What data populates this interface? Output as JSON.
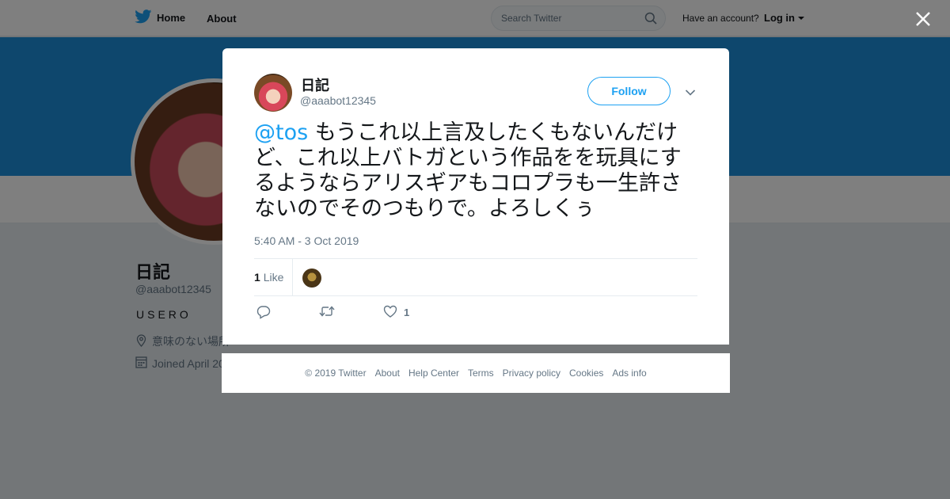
{
  "topbar": {
    "home_label": "Home",
    "about_label": "About",
    "search_placeholder": "Search Twitter",
    "account_prompt": "Have an account?",
    "login_label": "Log in"
  },
  "profile": {
    "name": "日記",
    "handle": "@aaabot12345",
    "bio": "USERO",
    "location": "意味のない場所",
    "joined": "Joined April 20"
  },
  "tweet": {
    "author_name": "日記",
    "author_handle": "@aaabot12345",
    "follow_label": "Follow",
    "mention": "@tos",
    "text": " もうこれ以上言及したくもないんだけど、これ以上バトガという作品をを玩具にするようならアリスギアもコロプラも一生許さないのでそのつもりで。よろしくぅ",
    "timestamp": "5:40 AM - 3 Oct 2019",
    "likes_count": "1",
    "likes_label": "Like",
    "action_like_count": "1"
  },
  "footer": {
    "links": [
      "© 2019 Twitter",
      "About",
      "Help Center",
      "Terms",
      "Privacy policy",
      "Cookies",
      "Ads info"
    ]
  },
  "colors": {
    "accent": "#1da1f2",
    "banner": "#1c8fdb",
    "muted_text": "#657786"
  },
  "icons": [
    "twitter-bird-icon",
    "search-icon",
    "close-icon",
    "chevron-down-icon",
    "reply-icon",
    "retweet-icon",
    "heart-icon",
    "location-icon",
    "calendar-icon"
  ]
}
